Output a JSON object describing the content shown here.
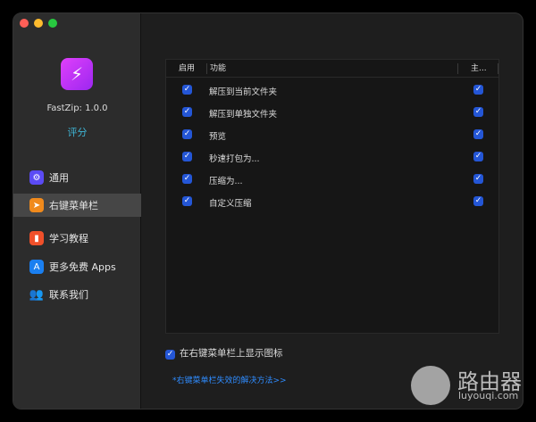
{
  "app": {
    "version": "FastZip: 1.0.0",
    "rate": "评分"
  },
  "sidebar": {
    "items": [
      {
        "label": "通用",
        "icon": "gear-icon",
        "color": "#5b4bf5"
      },
      {
        "label": "右键菜单栏",
        "icon": "cursor-icon",
        "color": "#f08a1c",
        "selected": true
      },
      {
        "label": "学习教程",
        "icon": "book-icon",
        "color": "#f0502a"
      },
      {
        "label": "更多免费 Apps",
        "icon": "app-store-icon",
        "color": "#1a7ff0"
      },
      {
        "label": "联系我们",
        "icon": "people-icon",
        "color": "none"
      }
    ]
  },
  "table": {
    "headers": [
      "启用",
      "功能",
      "主..."
    ],
    "rows": [
      {
        "enabled": true,
        "label": "解压到当前文件夹",
        "main": true
      },
      {
        "enabled": true,
        "label": "解压到单独文件夹",
        "main": true
      },
      {
        "enabled": true,
        "label": "预览",
        "main": true
      },
      {
        "enabled": true,
        "label": "秒速打包为...",
        "main": true
      },
      {
        "enabled": true,
        "label": "压缩为...",
        "main": true
      },
      {
        "enabled": true,
        "label": "自定义压缩",
        "main": true
      }
    ]
  },
  "show_icon": {
    "label": "在右键菜单栏上显示图标",
    "checked": true
  },
  "help_link": "*右键菜单栏失效的解决方法>>",
  "watermark": {
    "title": "路由器",
    "sub": "luyouqi.com"
  }
}
